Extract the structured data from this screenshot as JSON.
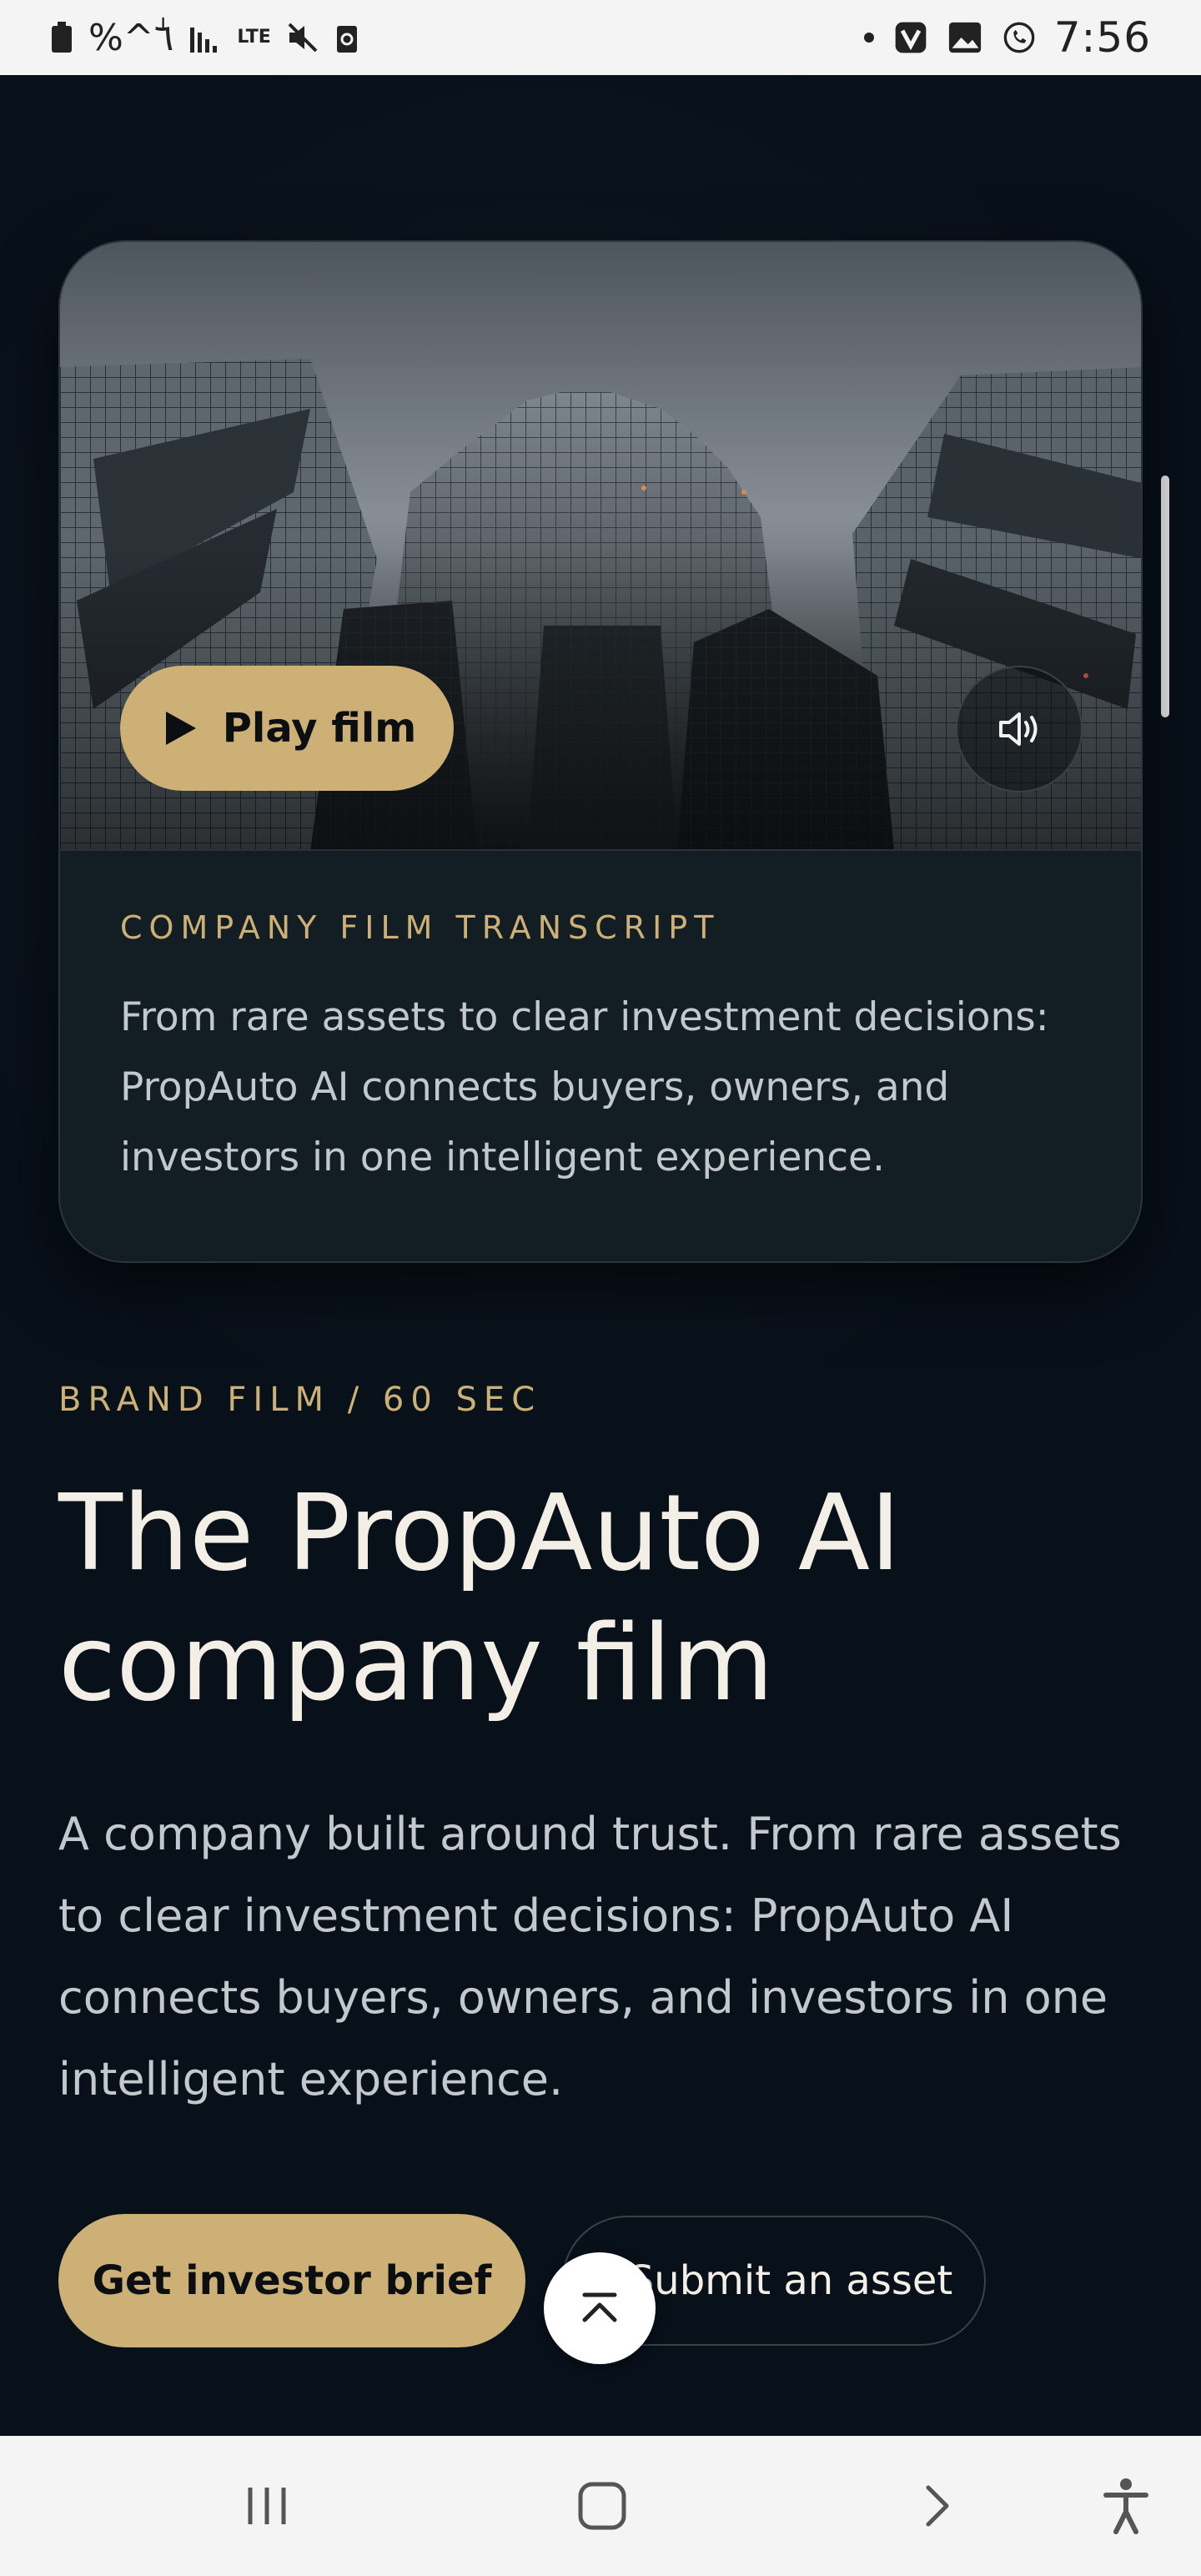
{
  "status_bar": {
    "left_text": "%^ٰ٦",
    "network": "LTE",
    "time": "7:56",
    "icons": [
      "battery-icon",
      "signal-icon",
      "lte-icon",
      "mute-icon",
      "recycle-icon",
      "dot-icon",
      "vivaldi-icon",
      "gallery-icon",
      "whatsapp-icon"
    ]
  },
  "video_card": {
    "play_label": "Play film",
    "sound_icon": "speaker-icon",
    "transcript_heading": "COMPANY FILM TRANSCRIPT",
    "transcript_text": "From rare assets to clear investment decisions: PropAuto AI connects buyers, owners, and investors in one intelligent experience."
  },
  "intro": {
    "eyebrow": "BRAND FILM / 60 SEC",
    "headline": "The PropAuto AI company film",
    "body": "A company built around trust. From rare assets to clear investment decisions: PropAuto AI connects buyers, owners, and investors in one intelligent experience."
  },
  "actions": {
    "primary_label": "Get investor brief",
    "secondary_label": "Submit an asset",
    "back_to_top_icon": "arrow-up-to-top-icon"
  },
  "nav_bar": {
    "items": [
      "recent-apps-icon",
      "home-icon",
      "back-icon",
      "accessibility-icon"
    ]
  },
  "colors": {
    "accent": "#cdb076",
    "background": "#08101a",
    "card": "#131d24",
    "headline": "#f3efe6",
    "body": "#c3c8cc"
  }
}
